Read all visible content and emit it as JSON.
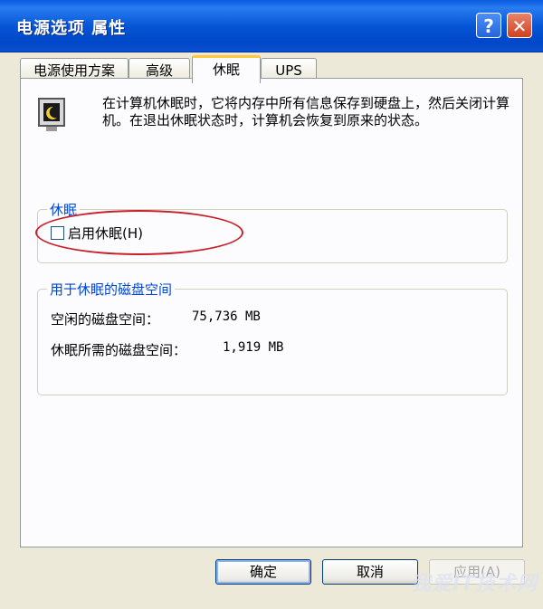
{
  "window": {
    "title": "电源选项 属性",
    "help_glyph": "?",
    "close_glyph": "✕"
  },
  "tabs": [
    {
      "label": "电源使用方案",
      "active": false
    },
    {
      "label": "高级",
      "active": false
    },
    {
      "label": "休眠",
      "active": true
    },
    {
      "label": "UPS",
      "active": false
    }
  ],
  "hibernate": {
    "icon": "monitor-moon-icon",
    "description": "在计算机休眠时，它将内存中所有信息保存到硬盘上，然后关闭计算机。在退出休眠状态时，计算机会恢复到原来的状态。",
    "group_label": "休眠",
    "checkbox_label": "启用休眠(H)",
    "checkbox_checked": false
  },
  "disk_space": {
    "group_label": "用于休眠的磁盘空间",
    "free_label": "空闲的磁盘空间：",
    "free_value": "75,736 MB",
    "required_label": "休眠所需的磁盘空间：",
    "required_value": "1,919 MB"
  },
  "buttons": {
    "ok": "确定",
    "cancel": "取消",
    "apply": "应用(A)"
  },
  "watermark": "我爱IT技术网",
  "colors": {
    "titlebar": "#0656d6",
    "tab_highlight": "#ffc83c",
    "group_label": "#0046d5",
    "annotation": "#c8202a"
  }
}
